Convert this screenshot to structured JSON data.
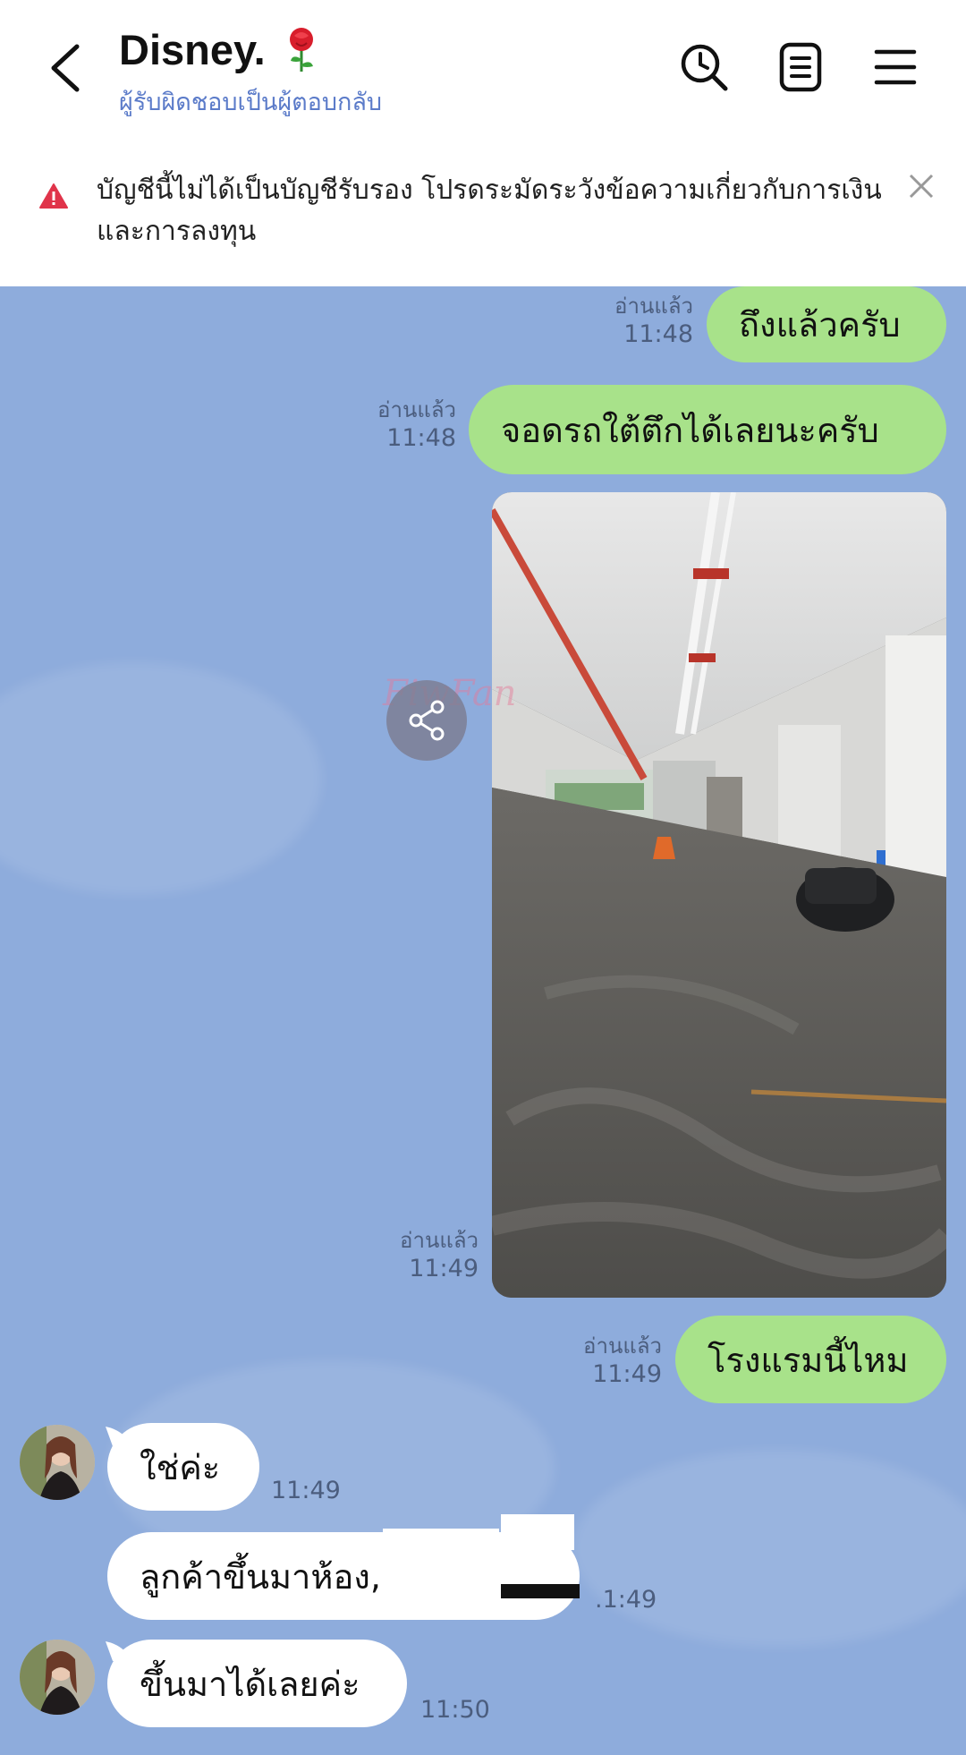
{
  "header": {
    "title": "Disney.",
    "subtitle": "ผู้รับผิดชอบเป็นผู้ตอบกลับ"
  },
  "banner": {
    "text": "บัญชีนี้ไม่ได้เป็นบัญชีรับรอง โปรดระมัดระวังข้อความเกี่ยวกับการเงินและการลงทุน"
  },
  "watermark": "FiwFan",
  "messages": [
    {
      "dir": "out",
      "text": "ถึงแล้วครับ",
      "status": "อ่านแล้ว",
      "time": "11:48"
    },
    {
      "dir": "out",
      "text": "จอดรถใต้ตึกได้เลยนะครับ",
      "status": "อ่านแล้ว",
      "time": "11:48"
    },
    {
      "dir": "out",
      "type": "image",
      "status": "อ่านแล้ว",
      "time": "11:49"
    },
    {
      "dir": "out",
      "text": "โรงแรมนี้ไหม",
      "status": "อ่านแล้ว",
      "time": "11:49"
    },
    {
      "dir": "in",
      "text": "ใช่ค่ะ",
      "time": "11:49"
    },
    {
      "dir": "in",
      "text": "ลูกค้าขึ้นมาห้อง,",
      "time": ".1:49"
    },
    {
      "dir": "in",
      "text": "ขึ้นมาได้เลยค่ะ",
      "time": "11:50"
    }
  ],
  "colors": {
    "chat_bg": "#8eacdc",
    "bubble_out": "#a8e28a",
    "bubble_in": "#ffffff",
    "subtitle": "#5b7bc9",
    "warning": "#e0344a"
  },
  "icons": [
    "back-arrow-icon",
    "rose-emoji-icon",
    "search-clock-icon",
    "notes-icon",
    "menu-icon",
    "warning-icon",
    "close-icon",
    "share-icon"
  ]
}
